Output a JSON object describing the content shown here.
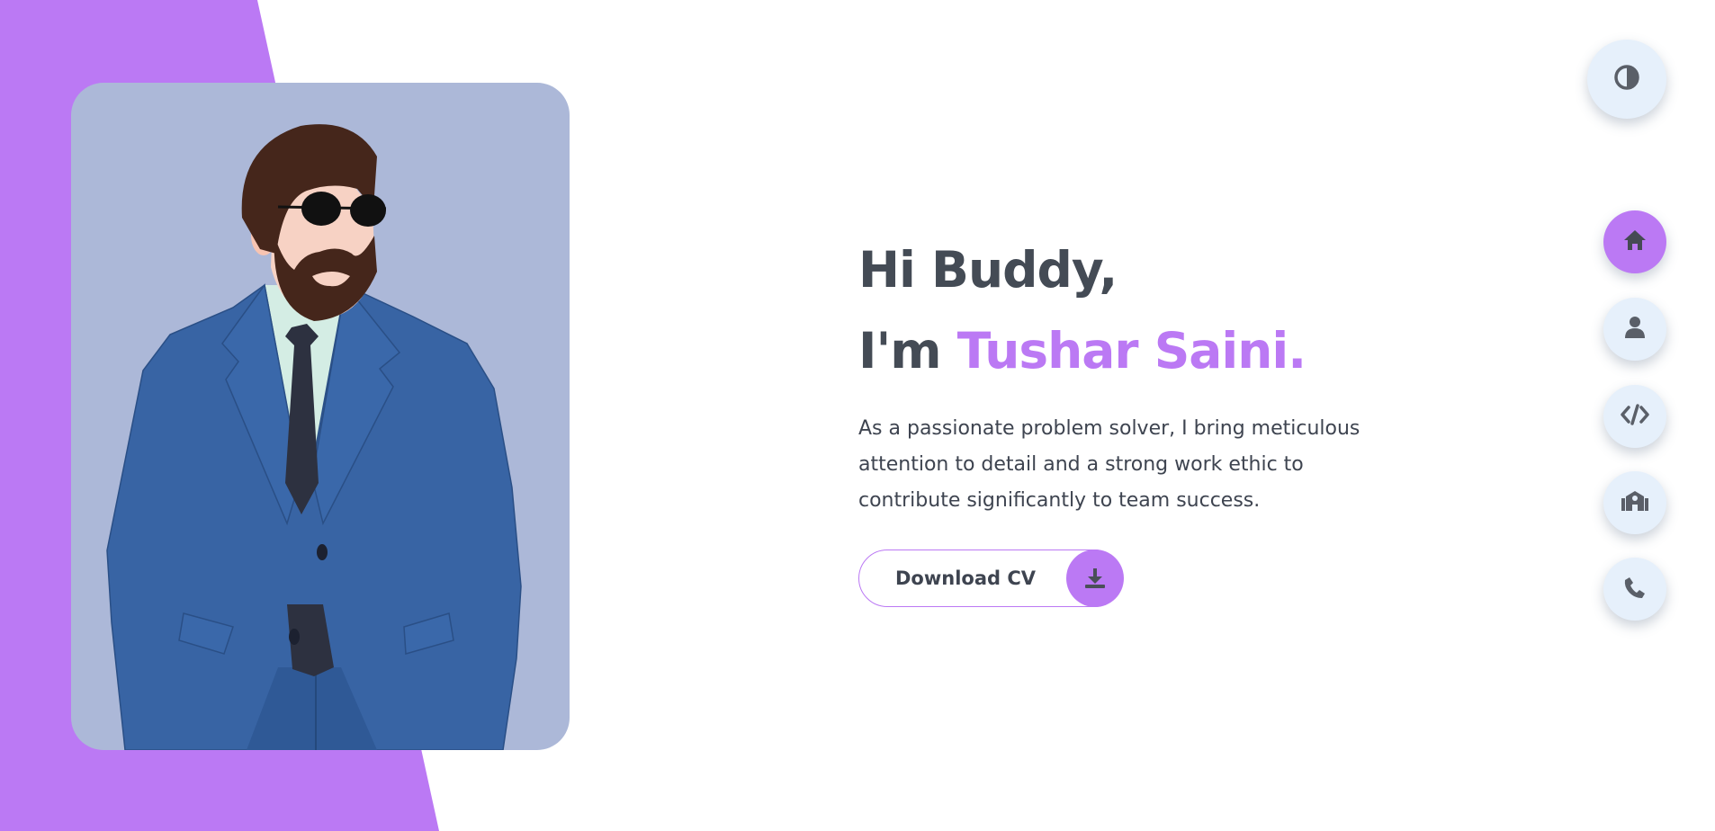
{
  "hero": {
    "greeting_line1": "Hi Buddy,",
    "greeting_prefix": "I'm",
    "name": "Tushar Saini.",
    "intro": "As a passionate problem solver, I bring meticulous attention to detail and a strong work ethic to contribute significantly to team success.",
    "download_label": "Download CV"
  },
  "nav": {
    "theme_icon": "contrast-icon",
    "items": [
      {
        "icon": "home-icon",
        "active": true
      },
      {
        "icon": "user-icon",
        "active": false
      },
      {
        "icon": "code-icon",
        "active": false
      },
      {
        "icon": "school-icon",
        "active": false
      },
      {
        "icon": "phone-icon",
        "active": false
      }
    ]
  },
  "colors": {
    "accent": "#bb79f4",
    "text": "#444b55",
    "button_bg": "#e6f0fb",
    "portrait_bg": "#acb8d8",
    "suit": "#3864a4"
  }
}
